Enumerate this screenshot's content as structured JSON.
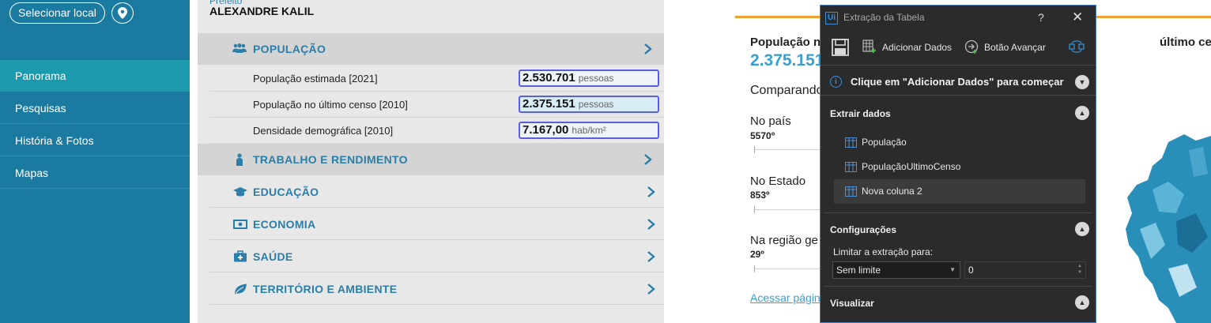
{
  "sidebar": {
    "select_location": "Selecionar local",
    "items": [
      {
        "label": "Panorama"
      },
      {
        "label": "Pesquisas"
      },
      {
        "label": "História & Fotos"
      },
      {
        "label": "Mapas"
      }
    ]
  },
  "main": {
    "prefeito_label": "Prefeito",
    "prefeito_name": "ALEXANDRE KALIL",
    "sections": [
      {
        "title": "POPULAÇÃO",
        "icon": "people-icon"
      },
      {
        "title": "TRABALHO E RENDIMENTO",
        "icon": "worker-icon"
      },
      {
        "title": "EDUCAÇÃO",
        "icon": "graduation-cap-icon"
      },
      {
        "title": "ECONOMIA",
        "icon": "money-icon"
      },
      {
        "title": "SAÚDE",
        "icon": "medical-kit-icon"
      },
      {
        "title": "TERRITÓRIO E AMBIENTE",
        "icon": "leaf-icon"
      }
    ],
    "rows": [
      {
        "label": "População estimada [2021]",
        "value": "2.530.701",
        "unit": "pessoas"
      },
      {
        "label": "População no último censo [2010]",
        "value": "2.375.151",
        "unit": "pessoas"
      },
      {
        "label": "Densidade demográfica [2010]",
        "value": "7.167,00",
        "unit": "hab/km²"
      }
    ]
  },
  "content": {
    "title_start": "População no",
    "title_end": "último censo",
    "big_value": "2.375.151",
    "comparing": "Comparando",
    "rankings": [
      {
        "label": "No país",
        "rank": "5570º"
      },
      {
        "label": "No Estado",
        "rank": "853º"
      },
      {
        "label": "Na região ge",
        "rank": "29º"
      }
    ],
    "link": "Acessar págin"
  },
  "panel": {
    "logo": "Ui",
    "title": "Extração da Tabela",
    "help": "?",
    "close": "✕",
    "toolbar": {
      "add_data": "Adicionar Dados",
      "next_button": "Botão Avançar"
    },
    "info": "Clique em \"Adicionar Dados\" para começar",
    "extract_title": "Extrair dados",
    "columns": [
      "População",
      "PopulaçãoUltimoCenso",
      "Nova coluna 2"
    ],
    "config_title": "Configurações",
    "limit_label": "Limitar a extração para:",
    "limit_value": "Sem limite",
    "limit_number": "0",
    "visualize_title": "Visualizar"
  },
  "colors": {
    "sidebar": "#1b7aa0",
    "accent": "#2b7ea8",
    "panel_bg": "#2b2b2b",
    "highlight_border": "#5a5ee0"
  }
}
